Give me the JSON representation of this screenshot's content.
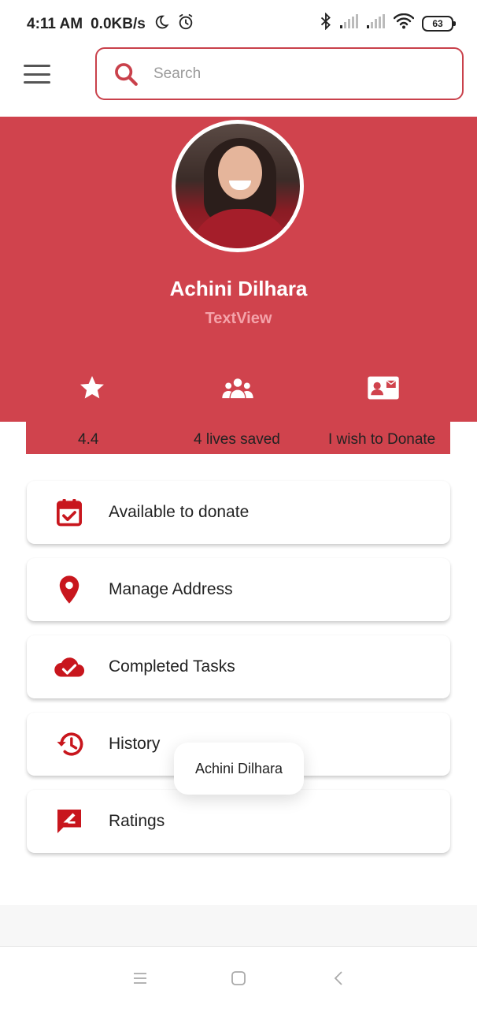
{
  "status_bar": {
    "time": "4:11 AM",
    "network_speed": "0.0KB/s",
    "battery_level": "63",
    "icons": [
      "moon-icon",
      "alarm-icon",
      "bluetooth-icon",
      "signal-icon",
      "signal-icon",
      "wifi-icon",
      "battery-icon"
    ]
  },
  "header": {
    "menu_icon": "hamburger-menu-icon",
    "search_icon": "search-icon",
    "search_placeholder": "Search",
    "search_value": ""
  },
  "profile": {
    "name": "Achini Dilhara",
    "subtitle": "TextView"
  },
  "stats": [
    {
      "icon": "star-icon",
      "label": "4.4"
    },
    {
      "icon": "people-icon",
      "label": "4 lives saved"
    },
    {
      "icon": "contact-card-icon",
      "label": "I wish to Donate"
    }
  ],
  "menu": [
    {
      "icon": "calendar-check-icon",
      "label": "Available to donate"
    },
    {
      "icon": "location-pin-icon",
      "label": "Manage Address"
    },
    {
      "icon": "cloud-check-icon",
      "label": "Completed Tasks"
    },
    {
      "icon": "history-icon",
      "label": "History"
    },
    {
      "icon": "rate-review-icon",
      "label": "Ratings"
    }
  ],
  "toast": {
    "text": "Achini Dilhara"
  },
  "nav_bar": {
    "icons": [
      "recents-icon",
      "home-icon",
      "back-icon"
    ]
  },
  "colors": {
    "accent": "#d0434d",
    "icon_red": "#c8161d",
    "search_border": "#c9414b",
    "subtitle": "#f4a3aa"
  }
}
